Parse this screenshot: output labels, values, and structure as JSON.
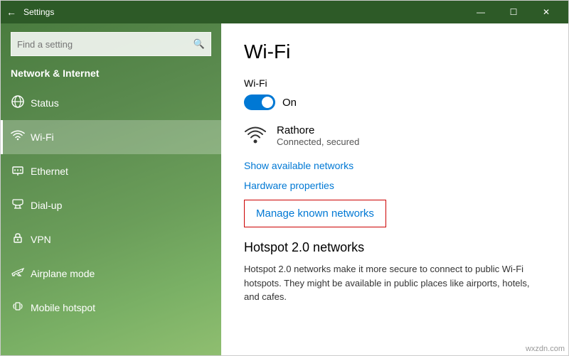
{
  "titlebar": {
    "title": "Settings",
    "back_label": "←",
    "minimize": "—",
    "maximize": "☐",
    "close": "✕"
  },
  "sidebar": {
    "search_placeholder": "Find a setting",
    "section_title": "Network & Internet",
    "items": [
      {
        "id": "status",
        "label": "Status",
        "icon": "🌐"
      },
      {
        "id": "wifi",
        "label": "Wi-Fi",
        "icon": "📶"
      },
      {
        "id": "ethernet",
        "label": "Ethernet",
        "icon": "🖥"
      },
      {
        "id": "dialup",
        "label": "Dial-up",
        "icon": "📞"
      },
      {
        "id": "vpn",
        "label": "VPN",
        "icon": "🔒"
      },
      {
        "id": "airplane",
        "label": "Airplane mode",
        "icon": "✈"
      },
      {
        "id": "mobile",
        "label": "Mobile hotspot",
        "icon": "📡"
      }
    ]
  },
  "right_panel": {
    "title": "Wi-Fi",
    "wifi_label": "Wi-Fi",
    "toggle_state": "On",
    "network_name": "Rathore",
    "network_status": "Connected, secured",
    "show_networks_link": "Show available networks",
    "hardware_props_link": "Hardware properties",
    "manage_networks_link": "Manage known networks",
    "hotspot_title": "Hotspot 2.0 networks",
    "hotspot_description": "Hotspot 2.0 networks make it more secure to connect to public Wi-Fi hotspots. They might be available in public places like airports, hotels, and cafes."
  },
  "watermark": "wxzdn.com"
}
